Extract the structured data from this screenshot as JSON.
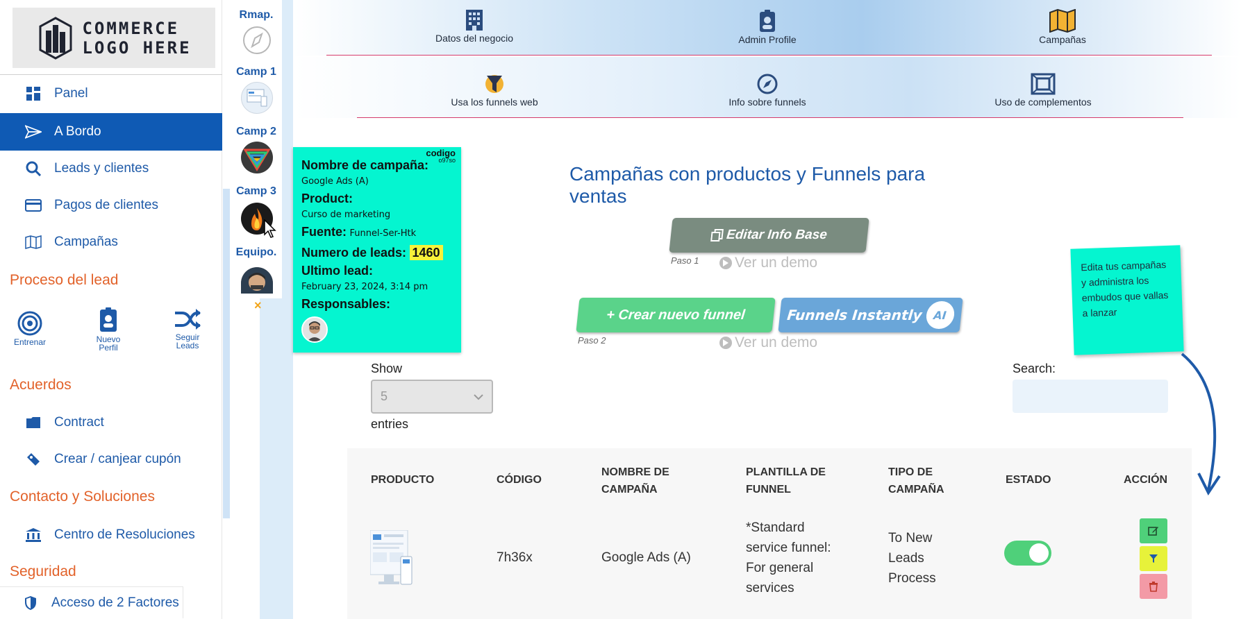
{
  "logo": {
    "line1": "COMMERCE",
    "line2": "LOGO HERE"
  },
  "sidebar": {
    "items": [
      {
        "label": "Panel"
      },
      {
        "label": "A Bordo"
      },
      {
        "label": "Leads y clientes"
      },
      {
        "label": "Pagos de clientes"
      },
      {
        "label": "Campañas"
      }
    ],
    "section_lead": "Proceso del lead",
    "shortcuts": [
      {
        "label_1": "Entrenar",
        "label_2": ""
      },
      {
        "label_1": "Nuevo",
        "label_2": "Perfil"
      },
      {
        "label_1": "Seguir",
        "label_2": "Leads"
      }
    ],
    "section_acuerdos": "Acuerdos",
    "acuerdos_items": [
      {
        "label": "Contract"
      },
      {
        "label": "Crear / canjear cupón"
      }
    ],
    "section_contacto": "Contacto y Soluciones",
    "contacto_items": [
      {
        "label": "Centro de Resoluciones"
      }
    ],
    "section_seguridad": "Seguridad",
    "seguridad_items": [
      {
        "label": "Acceso de 2 Factores"
      }
    ]
  },
  "strip": {
    "labels": [
      "Rmap.",
      "Camp 1",
      "Camp 2",
      "Camp 3",
      "Equipo."
    ],
    "close": "×"
  },
  "topnav": {
    "row1": [
      {
        "label": "Datos del negocio"
      },
      {
        "label": "Admin Profile"
      },
      {
        "label": "Campañas"
      }
    ],
    "row2": [
      {
        "label": "Usa los funnels web"
      },
      {
        "label": "Info sobre funnels"
      },
      {
        "label": "Uso de complementos"
      }
    ]
  },
  "card": {
    "code_label": "codigo",
    "code_value": "o97so",
    "name_label": "Nombre de campaña:",
    "name_value": "Google Ads (A)",
    "product_label": "Product:",
    "product_value": "Curso de marketing",
    "source_label": "Fuente:",
    "source_value": "Funnel-Ser-Htk",
    "leads_label": "Numero de leads:",
    "leads_value": "1460",
    "last_lead_label": "Ultimo lead:",
    "last_lead_value": "February 23, 2024, 3:14 pm",
    "resp_label": "Responsables:"
  },
  "panel": {
    "title": "Campañas con productos y Funnels para ventas",
    "edit_button": "Editar Info Base",
    "step1": "Paso 1",
    "demo1": "Ver un demo",
    "create_button": "+ Crear nuevo funnel",
    "instantly_button": "Funnels Instantly",
    "ai_badge": "AI",
    "step2": "Paso 2",
    "demo2": "Ver un demo"
  },
  "sticky_note": "Edita tus campañas y administra los embudos que vallas a lanzar",
  "datatable": {
    "show_label": "Show",
    "entries_label": "entries",
    "length_value": "5",
    "search_label": "Search:",
    "search_value": ""
  },
  "table": {
    "headers": {
      "producto": "PRODUCTO",
      "codigo": "CÓDIGO",
      "nombre_1": "NOMBRE DE",
      "nombre_2": "CAMPAÑA",
      "plantilla_1": "PLANTILLA DE",
      "plantilla_2": "FUNNEL",
      "tipo_1": "TIPO DE",
      "tipo_2": "CAMPAÑA",
      "estado": "ESTADO",
      "accion": "ACCIÓN"
    },
    "row": {
      "codigo": "7h36x",
      "nombre": "Google Ads (A)",
      "plantilla_1": "*Standard",
      "plantilla_2": "service funnel:",
      "plantilla_3": "For general",
      "plantilla_4": "services",
      "tipo_1": "To New",
      "tipo_2": "Leads",
      "tipo_3": "Process",
      "estado_on": true
    }
  },
  "colors": {
    "primary": "#1e5aa8",
    "active_nav": "#0f5ab4",
    "section_orange": "#e2622a",
    "card_teal": "#05f5d0",
    "leads_yellow": "#f6f23a",
    "btn_gray": "#7a8c80",
    "btn_green": "#5ad38a",
    "btn_blue": "#6aa6d9",
    "toggle_green": "#4fd07a",
    "edit_green": "#4fd07a",
    "filter_yellow": "#e7f23a",
    "delete_pink": "#f39aa6",
    "divider_pink": "#d43a6b"
  }
}
